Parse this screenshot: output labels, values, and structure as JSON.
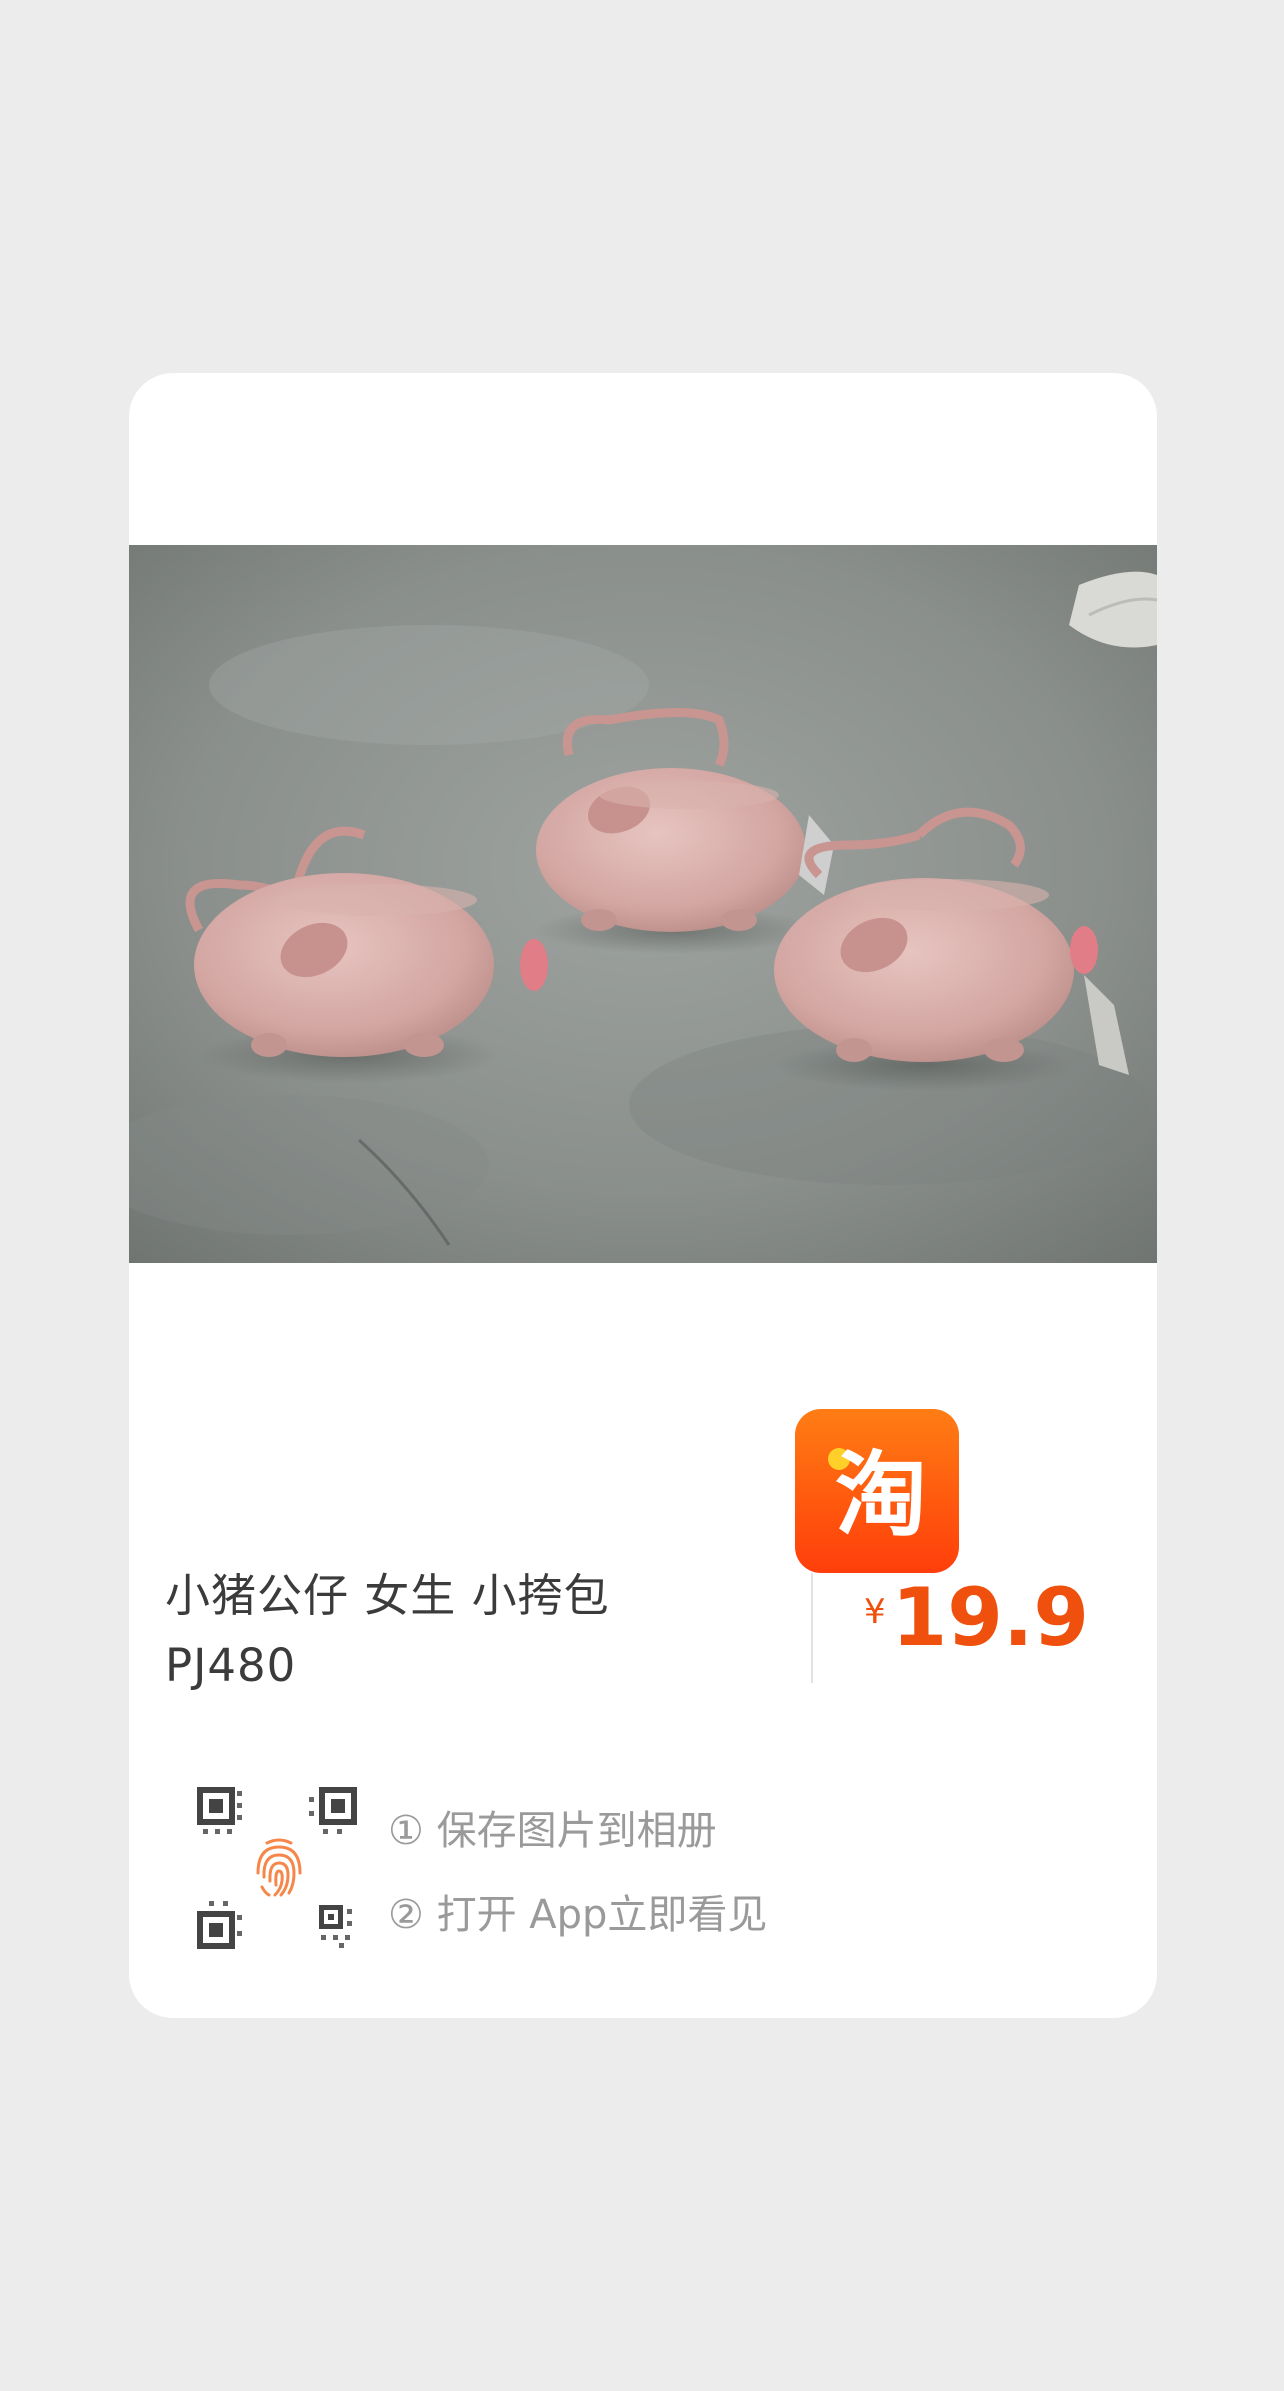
{
  "product": {
    "title_line1": "小猪公仔 女生 小挎包",
    "title_line2": "PJ480",
    "price_symbol": "¥",
    "price_value": "19.9",
    "image_alt": "pink-plush-pig-crossbody-bags-photo"
  },
  "instructions": {
    "step1": "① 保存图片到相册",
    "step2": "② 打开 App立即看见"
  },
  "brand": {
    "logo_icon": "taobao-logo-icon",
    "logo_glyph": "淘"
  },
  "colors": {
    "price": "#f0500d",
    "brand_orange": "#ff5a0e",
    "fingerprint": "#f5874a"
  }
}
